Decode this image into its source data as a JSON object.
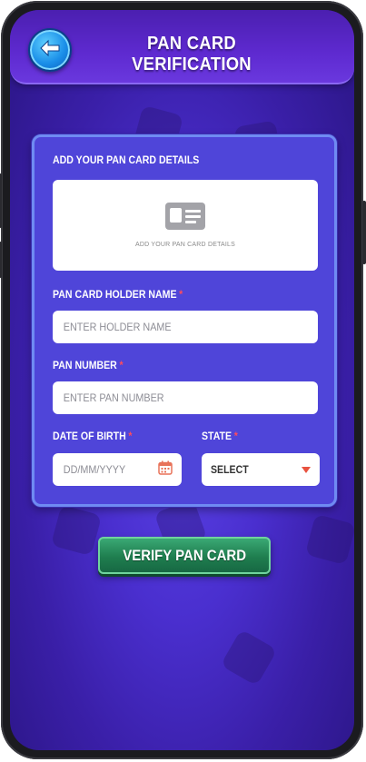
{
  "header": {
    "title": "PAN CARD VERIFICATION",
    "back_icon": "arrow-left-icon"
  },
  "form": {
    "section_title": "ADD YOUR PAN CARD DETAILS",
    "upload_hint": "ADD YOUR PAN CARD DETAILS",
    "upload_icon": "id-card-icon",
    "holder_name": {
      "label": "PAN CARD HOLDER NAME",
      "required": "*",
      "placeholder": "ENTER HOLDER NAME",
      "value": ""
    },
    "pan_number": {
      "label": "PAN NUMBER",
      "required": "*",
      "placeholder": "ENTER PAN NUMBER",
      "value": ""
    },
    "dob": {
      "label": "DATE OF BIRTH",
      "required": "*",
      "placeholder": "DD/MM/YYYY",
      "value": "",
      "icon": "calendar-icon"
    },
    "state": {
      "label": "STATE",
      "required": "*",
      "value": "SELECT",
      "icon": "caret-down-icon"
    }
  },
  "actions": {
    "verify_label": "VERIFY PAN CARD"
  },
  "colors": {
    "background": "#4a2fcf",
    "card": "#4f45d9",
    "required": "#ff4b5c",
    "verify_button": "#1f7e4f",
    "back_button": "#1a8ee8"
  }
}
